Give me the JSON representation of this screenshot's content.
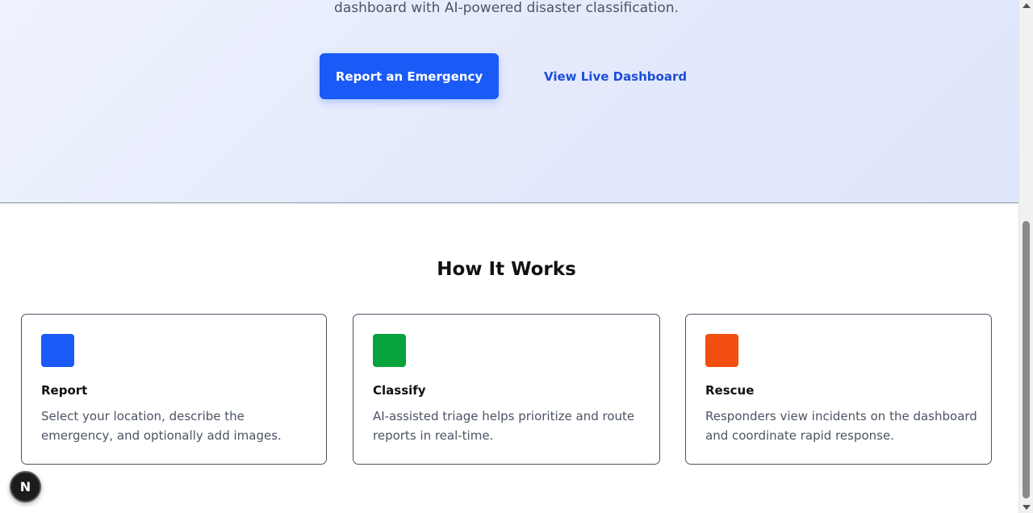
{
  "hero": {
    "subtitle": "dashboard with AI-powered disaster classification.",
    "primary_button": "Report an Emergency",
    "secondary_link": "View Live Dashboard"
  },
  "how_it_works": {
    "title": "How It Works",
    "steps": [
      {
        "title": "Report",
        "description": "Select your location, describe the emergency, and optionally add images.",
        "icon_color": "#1a5af7",
        "icon": "blue-square-icon"
      },
      {
        "title": "Classify",
        "description": "AI-assisted triage helps prioritize and route reports in real-time.",
        "icon_color": "#07a23b",
        "icon": "green-square-icon"
      },
      {
        "title": "Rescue",
        "description": "Responders view incidents on the dashboard and coordinate rapid response.",
        "icon_color": "#f24e0f",
        "icon": "orange-square-icon"
      }
    ]
  },
  "dev_badge": {
    "label": "N"
  }
}
